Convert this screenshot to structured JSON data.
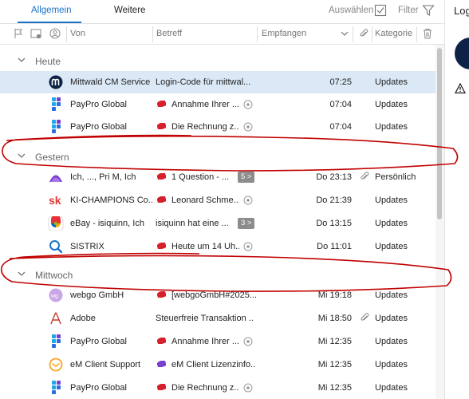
{
  "tabs": {
    "allgemein": "Allgemein",
    "weitere": "Weitere",
    "auswaehlen": "Auswählen",
    "filter": "Filter"
  },
  "columns": {
    "von": "Von",
    "betreff": "Betreff",
    "empfangen": "Empfangen",
    "kategorie": "Kategorie"
  },
  "groups": {
    "heute": "Heute",
    "gestern": "Gestern",
    "mittwoch": "Mittwoch"
  },
  "rows": [
    {
      "from": "Mittwald CM Service",
      "subject": "Login-Code für mittwal...",
      "time": "07:25",
      "category": "Updates"
    },
    {
      "from": "PayPro Global",
      "subject": "Annahme Ihrer ...",
      "time": "07:04",
      "category": "Updates"
    },
    {
      "from": "PayPro Global",
      "subject": "Die Rechnung z...",
      "time": "07:04",
      "category": "Updates"
    },
    {
      "from": "Ich, ..., Pri M, Ich",
      "subject": "1 Question - ...",
      "badge": "5 >",
      "time": "Do 23:13",
      "category": "Persönlich"
    },
    {
      "from": "KI-CHAMPIONS Co...",
      "subject": "Leonard Schme...",
      "time": "Do 21:39",
      "category": "Updates"
    },
    {
      "from": "eBay - isiquinn, Ich",
      "subject": "isiquinn hat eine ...",
      "badge": "3 >",
      "time": "Do 13:15",
      "category": "Updates"
    },
    {
      "from": "SISTRIX",
      "subject": "Heute um 14 Uh...",
      "time": "Do 11:01",
      "category": "Updates"
    },
    {
      "from": "webgo GmbH",
      "subject": "[webgoGmbH#2025...",
      "time": "Mi 19:18",
      "category": "Updates"
    },
    {
      "from": "Adobe",
      "subject": "Steuerfreie Transaktion ...",
      "time": "Mi 18:50",
      "category": "Updates"
    },
    {
      "from": "PayPro Global",
      "subject": "Annahme Ihrer ...",
      "time": "Mi 12:35",
      "category": "Updates"
    },
    {
      "from": "eM Client Support",
      "subject": "eM Client Lizenzinfo...",
      "time": "Mi 12:35",
      "category": "Updates"
    },
    {
      "from": "PayPro Global",
      "subject": "Die Rechnung z...",
      "time": "Mi 12:35",
      "category": "Updates"
    }
  ],
  "icons": {
    "mittwald": "mittwald-logo-icon",
    "paypro": "paypro-logo-icon",
    "team": "team-logo-icon",
    "ki": "ki-champions-logo-icon",
    "ebay": "ebay-logo-icon",
    "sistrix": "sistrix-search-icon",
    "webgo": "webgo-logo-icon",
    "adobe": "adobe-logo-icon",
    "emclient": "em-client-logo-icon"
  },
  "colors": {
    "accent": "#1a73c9",
    "selected_row": "#dbe9f7",
    "tag_red": "#d6202b",
    "tag_purple": "#7b3fd0",
    "annotation_ink": "#c00000"
  },
  "right_pane": {
    "title": "Logi"
  }
}
